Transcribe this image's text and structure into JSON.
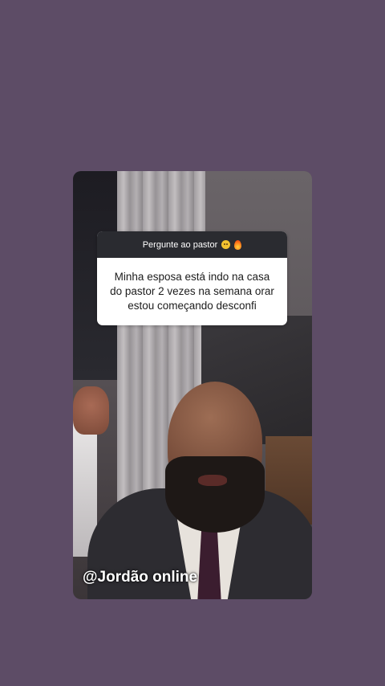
{
  "question_sticker": {
    "header": "Pergunte ao pastor",
    "header_emojis": [
      "grimacing-face-emoji",
      "fire-emoji"
    ],
    "question_lines": [
      "Minha esposa está indo na casa",
      "do pastor 2 vezes na semana orar",
      "estou começando desconfi"
    ]
  },
  "watermark": {
    "text": "@Jordão online"
  },
  "colors": {
    "page_background": "#5d4c66",
    "sticker_header_background": "#2a2b30",
    "sticker_body_background": "#ffffff"
  }
}
